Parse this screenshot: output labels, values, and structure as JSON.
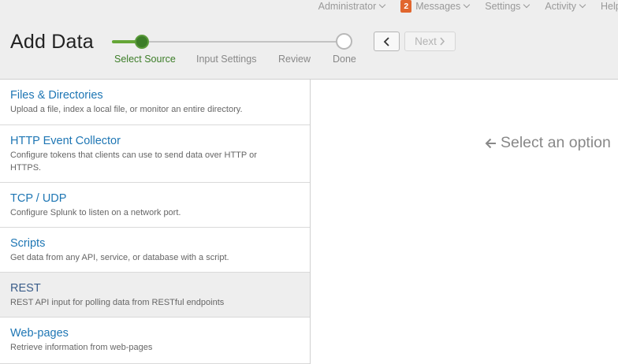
{
  "topnav": {
    "items": [
      {
        "label": "Administrator"
      },
      {
        "label": "Messages",
        "badge": "2"
      },
      {
        "label": "Settings"
      },
      {
        "label": "Activity"
      },
      {
        "label": "Help"
      }
    ]
  },
  "page": {
    "title": "Add Data"
  },
  "wizard": {
    "steps": [
      {
        "label": "Select Source"
      },
      {
        "label": "Input Settings"
      },
      {
        "label": "Review"
      },
      {
        "label": "Done"
      }
    ],
    "next_label": "Next"
  },
  "sources": [
    {
      "title": "Files & Directories",
      "desc": "Upload a file, index a local file, or monitor an entire directory."
    },
    {
      "title": "HTTP Event Collector",
      "desc": "Configure tokens that clients can use to send data over HTTP or HTTPS."
    },
    {
      "title": "TCP / UDP",
      "desc": "Configure Splunk to listen on a network port."
    },
    {
      "title": "Scripts",
      "desc": "Get data from any API, service, or database with a script."
    },
    {
      "title": "REST",
      "desc": "REST API input for polling data from RESTful endpoints"
    },
    {
      "title": "Web-pages",
      "desc": "Retrieve information from web-pages"
    }
  ],
  "content": {
    "hint": "Select an option"
  },
  "colors": {
    "accent_green": "#65a637",
    "link_blue": "#1e76b4",
    "badge_orange": "#e1662e"
  }
}
